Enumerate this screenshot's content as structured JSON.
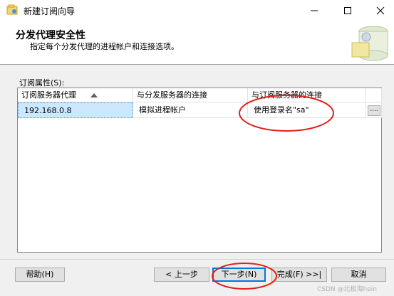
{
  "window": {
    "title": "新建订阅向导"
  },
  "header": {
    "title": "分发代理安全性",
    "subtitle": "指定每个分发代理的进程帐户和连接选项。"
  },
  "grid": {
    "label": "订阅属性(S):",
    "columns": [
      "订阅服务器代理",
      "与分发服务器的连接",
      "与订阅服务器的连接"
    ],
    "rows": [
      {
        "agent": "192.168.0.8",
        "distributor_conn": "模拟进程帐户",
        "subscriber_conn": "使用登录名\"sa\"",
        "button": "...."
      }
    ]
  },
  "buttons": {
    "help": "帮助(H)",
    "back": "< 上一步",
    "next": "下一步(N)",
    "finish": "完成(F) >>|",
    "cancel": "取消"
  },
  "watermark": "CSDN @北极海hein",
  "colors": {
    "selection": "#cce8ff",
    "annotation": "#e0201b",
    "focus": "#0078d7"
  }
}
